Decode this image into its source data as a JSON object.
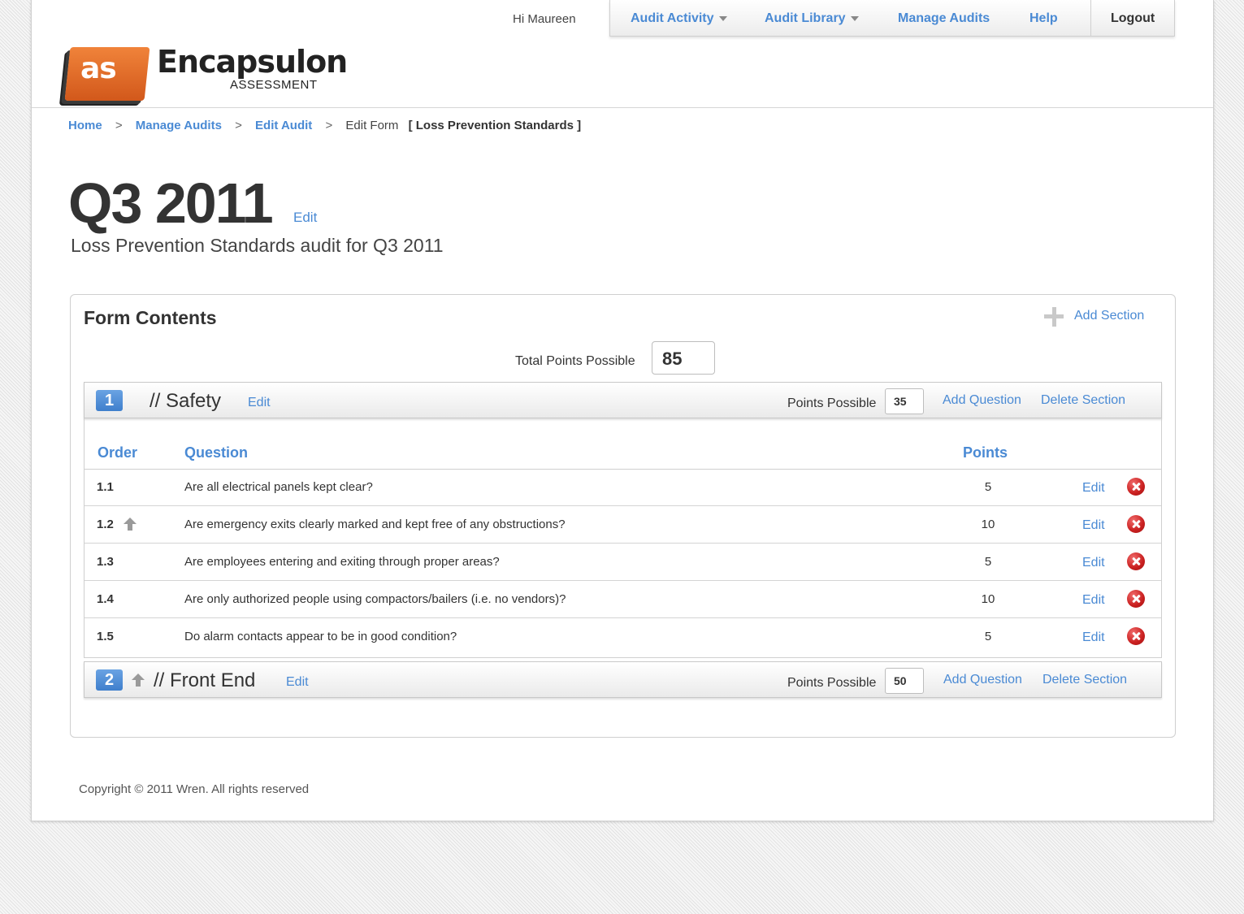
{
  "header": {
    "logo_badge": "as",
    "logo_name": "Encapsulon",
    "logo_sub": "ASSESSMENT",
    "greeting": "Hi Maureen",
    "nav": {
      "audit_activity": "Audit Activity",
      "audit_library": "Audit Library",
      "manage_audits": "Manage Audits",
      "help": "Help",
      "logout": "Logout"
    }
  },
  "breadcrumb": {
    "home": "Home",
    "manage_audits": "Manage Audits",
    "edit_audit": "Edit Audit",
    "sep": ">",
    "current": "Edit Form",
    "form_name": "[ Loss Prevention Standards ]"
  },
  "audit": {
    "title": "Q3 2011",
    "edit": "Edit",
    "description": "Loss Prevention Standards audit for Q3 2011"
  },
  "form": {
    "heading": "Form Contents",
    "add_section": "Add Section",
    "total_label": "Total Points Possible",
    "total_points": "85",
    "sections": [
      {
        "number": "1",
        "name": "// Safety",
        "edit": "Edit",
        "points_label": "Points Possible",
        "points": "35",
        "add_question": "Add Question",
        "delete_section": "Delete Section"
      },
      {
        "number": "2",
        "name": "// Front End",
        "edit": "Edit",
        "points_label": "Points Possible",
        "points": "50",
        "add_question": "Add Question",
        "delete_section": "Delete Section"
      }
    ],
    "columns": {
      "order": "Order",
      "question": "Question",
      "points": "Points"
    },
    "questions": [
      {
        "order": "1.1",
        "text": "Are all electrical panels kept clear?",
        "points": "5",
        "edit": "Edit"
      },
      {
        "order": "1.2",
        "text": "Are emergency exits clearly marked and kept free of any obstructions?",
        "points": "10",
        "edit": "Edit"
      },
      {
        "order": "1.3",
        "text": "Are employees entering and exiting through proper areas?",
        "points": "5",
        "edit": "Edit"
      },
      {
        "order": "1.4",
        "text": "Are only authorized people using compactors/bailers (i.e. no vendors)?",
        "points": "10",
        "edit": "Edit"
      },
      {
        "order": "1.5",
        "text": "Do alarm contacts appear to be in good condition?",
        "points": "5",
        "edit": "Edit"
      }
    ]
  },
  "footer": {
    "copyright": "Copyright © 2011 Wren. All rights reserved"
  },
  "icons": {
    "logo": "encapsulon-logo-icon",
    "dropdown": "caret-down-icon",
    "add": "plus-icon",
    "move_up": "arrow-up-icon",
    "delete": "delete-circle-icon"
  },
  "colors": {
    "link": "#4a8ad4",
    "badge": "#3f7fcc",
    "delete": "#c91f1f",
    "logo_orange": "#e06a28"
  }
}
